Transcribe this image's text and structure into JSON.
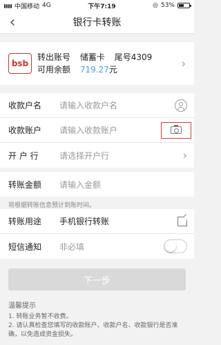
{
  "status": {
    "carrier": "中国移动",
    "network": "4G",
    "time": "下午7:19",
    "battery": "53%",
    "battery_level": 0.53
  },
  "nav": {
    "title": "银行卡转账"
  },
  "account": {
    "logo": "bsb",
    "from_label": "转出账号",
    "card_type": "储蓄卡",
    "tail_label": "尾号4309",
    "balance_label": "可用余额",
    "balance_value": "719.27",
    "currency": "元"
  },
  "form": {
    "payee_name": {
      "label": "收款户名",
      "placeholder": "请输入收款户名"
    },
    "payee_account": {
      "label": "收款账户",
      "placeholder": "请输入收款账户"
    },
    "bank": {
      "label": "开 户 行",
      "placeholder": "请选择开户行"
    },
    "amount": {
      "label": "转账金额",
      "placeholder": "请输入金额"
    },
    "amount_hint": "将根据转账信息预计到账时间。",
    "purpose": {
      "label": "转账用途",
      "value": "手机银行转账"
    },
    "sms": {
      "label": "短信通知",
      "placeholder": "非必填"
    }
  },
  "next_button": "下一步",
  "tips": {
    "title": "温馨提示",
    "item1": "1. 转账业务暂不收费。",
    "item2": "2. 请认真检查您填写的收款账户、收款户名、收款银行是否准确，以免造成资金损失。"
  }
}
